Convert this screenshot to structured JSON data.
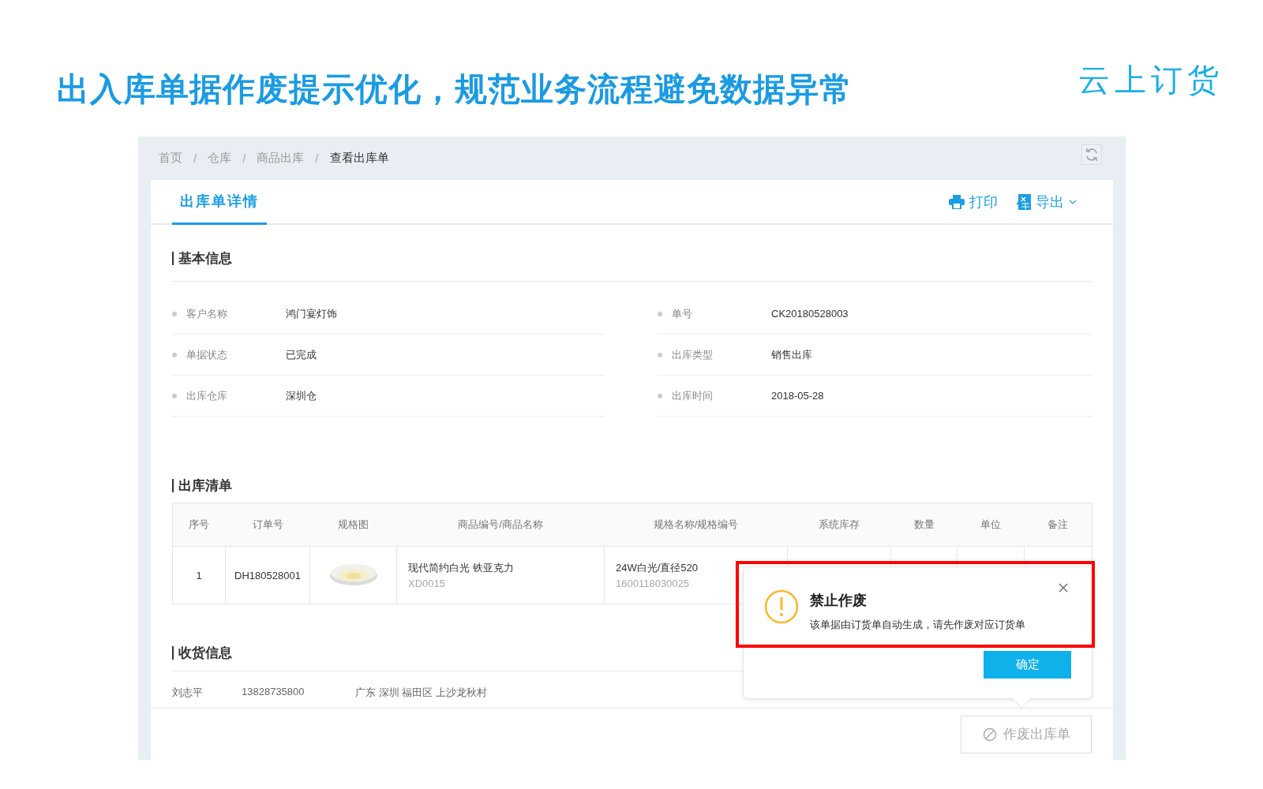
{
  "headline": "出入库单据作废提示优化，规范业务流程避免数据异常",
  "logo": "云上订货",
  "breadcrumb": [
    "首页",
    "仓库",
    "商品出库",
    "查看出库单"
  ],
  "breadcrumb_separator": "/",
  "tabs": [
    {
      "label": "出库单详情",
      "selected": true
    }
  ],
  "actions": [
    {
      "kind": "print",
      "label": "打印"
    },
    {
      "kind": "export",
      "label": "导出",
      "dropdown": true
    }
  ],
  "basic_info": {
    "title": "基本信息",
    "left": [
      {
        "label": "客户名称",
        "value": "鸿门宴灯饰"
      },
      {
        "label": "单据状态",
        "value": "已完成"
      },
      {
        "label": "出库仓库",
        "value": "深圳仓"
      }
    ],
    "right": [
      {
        "label": "单号",
        "value": "CK20180528003"
      },
      {
        "label": "出库类型",
        "value": "销售出库"
      },
      {
        "label": "出库时间",
        "value": "2018-05-28"
      }
    ]
  },
  "item_list": {
    "title": "出库清单",
    "columns": [
      "序号",
      "订单号",
      "规格图",
      "商品编号/商品名称",
      "规格名称/规格编号",
      "系统库存",
      "数量",
      "单位",
      "备注"
    ],
    "rows": [
      {
        "index": "1",
        "order_no": "DH180528001",
        "product_name": "现代简约白光 铁亚克力",
        "product_code": "XD0015",
        "spec_name": "24W白光/直径520",
        "spec_code": "1600118030025"
      }
    ]
  },
  "receiving": {
    "title": "收货信息",
    "name": "刘志平",
    "phone": "13828735800",
    "address": "广东 深圳 福田区 上沙龙秋村"
  },
  "void_button": {
    "label": "作废出库单",
    "disabled": true
  },
  "popover": {
    "title": "禁止作废",
    "message": "该单据由订货单自动生成，请先作废对应订货单",
    "confirm": "确定",
    "highlighted": true
  }
}
